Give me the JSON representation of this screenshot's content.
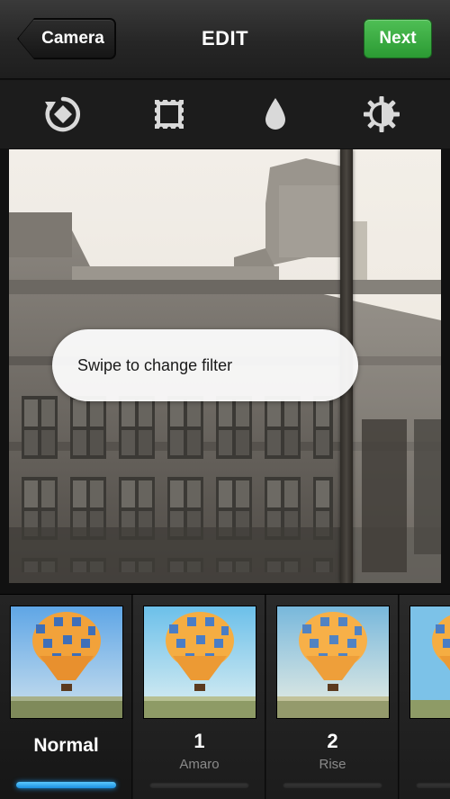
{
  "navbar": {
    "back_label": "Camera",
    "title": "EDIT",
    "next_label": "Next"
  },
  "toolbar": {
    "tools": [
      {
        "icon": "rotate-icon"
      },
      {
        "icon": "frame-icon"
      },
      {
        "icon": "tilt-shift-drop-icon"
      },
      {
        "icon": "lux-brightness-icon"
      }
    ]
  },
  "photo": {
    "hint_text": "Swipe to change filter"
  },
  "filters": [
    {
      "number": "",
      "name": "Normal",
      "selected": true
    },
    {
      "number": "1",
      "name": "Amaro",
      "selected": false
    },
    {
      "number": "2",
      "name": "Rise",
      "selected": false
    },
    {
      "number": "",
      "name": "",
      "selected": false
    }
  ],
  "colors": {
    "next_button": "#3aa842",
    "selected_indicator": "#1a8fe0"
  }
}
